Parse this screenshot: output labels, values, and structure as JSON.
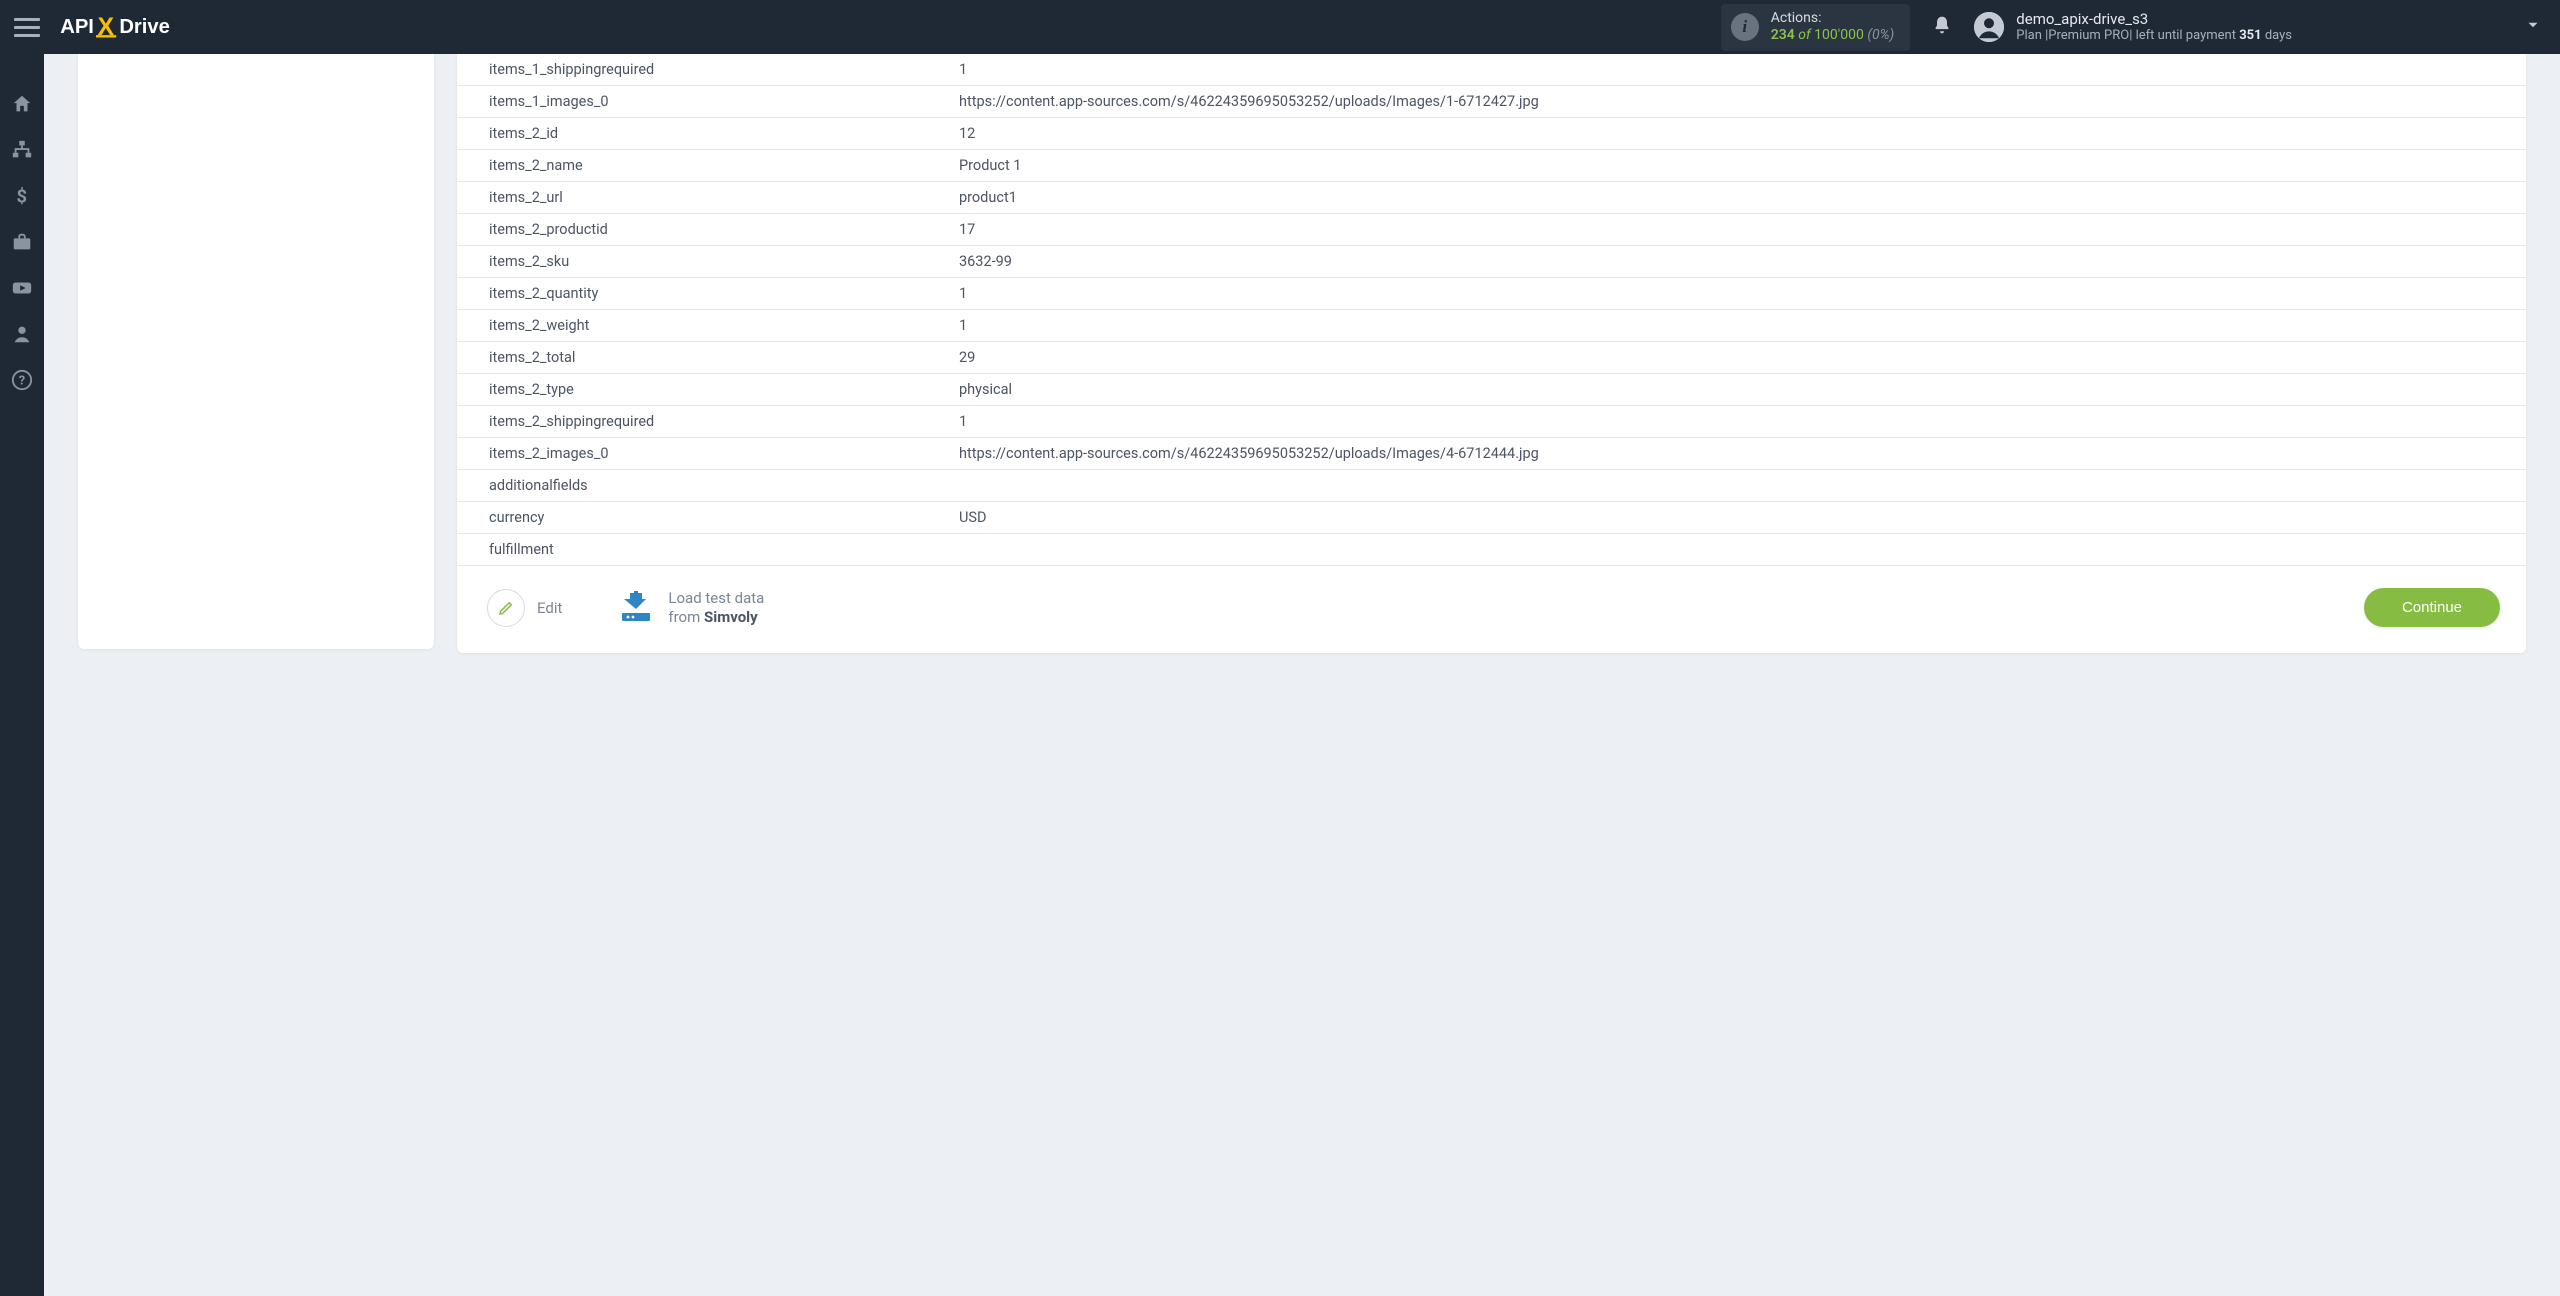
{
  "header": {
    "actions_label": "Actions:",
    "actions_used": "234",
    "actions_of": "of",
    "actions_limit": "100'000",
    "actions_pct": "(0%)",
    "username": "demo_apix-drive_s3",
    "plan_prefix": "Plan |",
    "plan_name": "Premium PRO",
    "plan_sep": "|",
    "plan_left_text": "left until payment",
    "plan_days_num": "351",
    "plan_days_word": "days"
  },
  "table": {
    "rows": [
      {
        "k": "items_1_shippingrequired",
        "v": "1"
      },
      {
        "k": "items_1_images_0",
        "v": "https://content.app-sources.com/s/46224359695053252/uploads/Images/1-6712427.jpg"
      },
      {
        "k": "items_2_id",
        "v": "12"
      },
      {
        "k": "items_2_name",
        "v": "Product 1"
      },
      {
        "k": "items_2_url",
        "v": "product1"
      },
      {
        "k": "items_2_productid",
        "v": "17"
      },
      {
        "k": "items_2_sku",
        "v": "3632-99"
      },
      {
        "k": "items_2_quantity",
        "v": "1"
      },
      {
        "k": "items_2_weight",
        "v": "1"
      },
      {
        "k": "items_2_total",
        "v": "29"
      },
      {
        "k": "items_2_type",
        "v": "physical"
      },
      {
        "k": "items_2_shippingrequired",
        "v": "1"
      },
      {
        "k": "items_2_images_0",
        "v": "https://content.app-sources.com/s/46224359695053252/uploads/Images/4-6712444.jpg"
      },
      {
        "k": "additionalfields",
        "v": ""
      },
      {
        "k": "currency",
        "v": "USD"
      },
      {
        "k": "fulfillment",
        "v": ""
      }
    ]
  },
  "buttons": {
    "edit": "Edit",
    "load_line1": "Load test data",
    "load_from": "from",
    "load_source": "Simvoly",
    "continue": "Continue"
  }
}
